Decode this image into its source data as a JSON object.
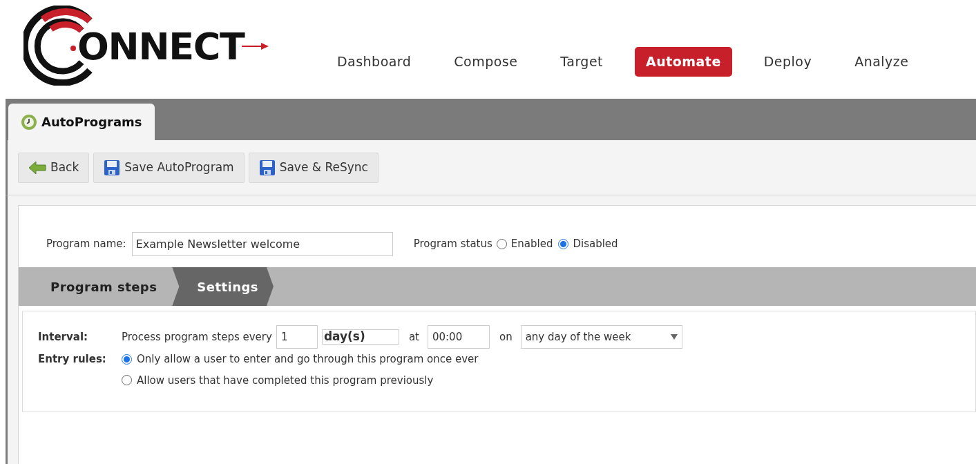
{
  "logo": {
    "text": "ONNECT"
  },
  "nav": [
    {
      "label": "Dashboard",
      "selected": false
    },
    {
      "label": "Compose",
      "selected": false
    },
    {
      "label": "Target",
      "selected": false
    },
    {
      "label": "Automate",
      "selected": true
    },
    {
      "label": "Deploy",
      "selected": false
    },
    {
      "label": "Analyze",
      "selected": false
    }
  ],
  "page_tab": {
    "label": "AutoPrograms"
  },
  "toolbar": [
    {
      "kind": "back",
      "label": "Back"
    },
    {
      "kind": "save",
      "label": "Save AutoProgram"
    },
    {
      "kind": "save",
      "label": "Save & ReSync"
    }
  ],
  "program_name": {
    "label": "Program name:",
    "value": "Example Newsletter welcome"
  },
  "program_status": {
    "label": "Program status",
    "options": [
      {
        "label": "Enabled",
        "selected": false
      },
      {
        "label": "Disabled",
        "selected": true
      }
    ]
  },
  "steps": [
    {
      "label": "Program steps",
      "selected": false
    },
    {
      "label": "Settings",
      "selected": true
    }
  ],
  "interval": {
    "label": "Interval:",
    "text": "Process program steps every",
    "count": "1",
    "unit": "day(s)",
    "at": "at",
    "time": "00:00",
    "on": "on",
    "day": "any day of the week"
  },
  "entry_rules": {
    "label": "Entry rules:",
    "options": [
      {
        "label": "Only allow a user to enter and go through this program once ever",
        "selected": true
      },
      {
        "label": "Allow users that have completed this program previously",
        "selected": false
      }
    ]
  }
}
